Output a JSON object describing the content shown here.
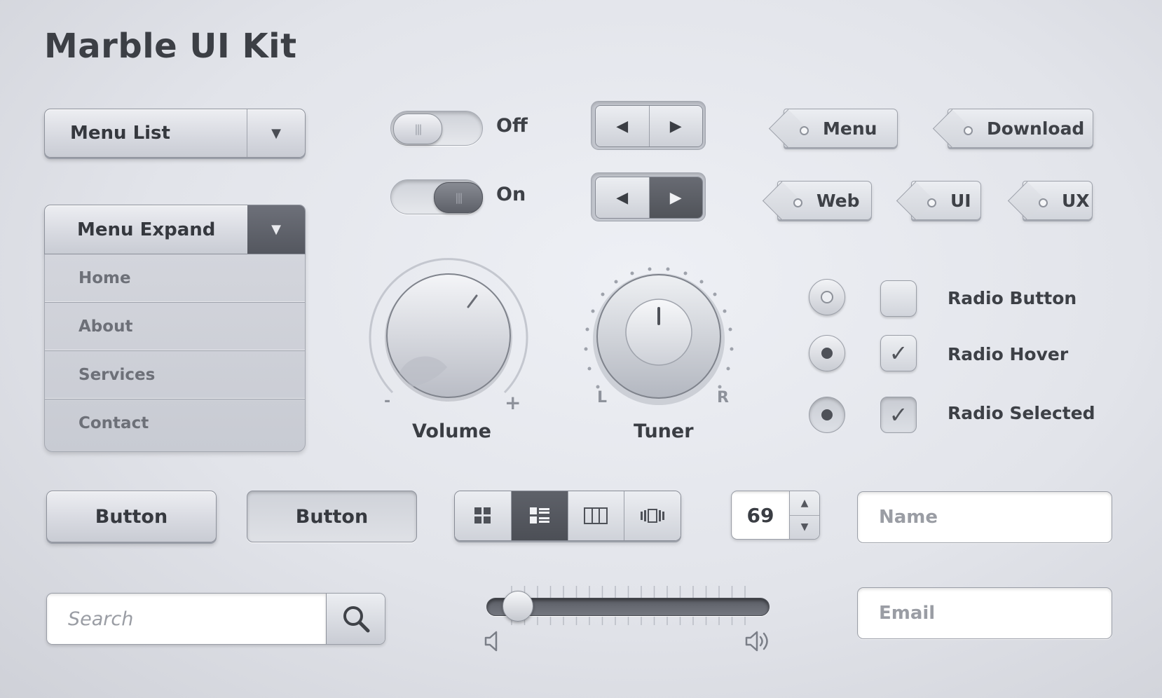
{
  "title": "Marble UI Kit",
  "menu_list": {
    "label": "Menu List",
    "arrow": "▼"
  },
  "menu_expand": {
    "label": "Menu Expand",
    "arrow": "▼",
    "items": [
      "Home",
      "About",
      "Services",
      "Contact"
    ]
  },
  "toggles": [
    {
      "label": "Off",
      "state": "off"
    },
    {
      "label": "On",
      "state": "on"
    }
  ],
  "arrow_buttons": {
    "left": "◀",
    "right": "▶"
  },
  "tags": [
    "Menu",
    "Download",
    "Web",
    "UI",
    "UX"
  ],
  "knobs": {
    "volume": {
      "label": "Volume",
      "min": "-",
      "max": "+"
    },
    "tuner": {
      "label": "Tuner",
      "left": "L",
      "right": "R"
    }
  },
  "radios": [
    {
      "label": "Radio Button",
      "checked": false
    },
    {
      "label": "Radio Hover",
      "checked": true
    },
    {
      "label": "Radio Selected",
      "checked": true
    }
  ],
  "check_mark": "✓",
  "buttons": [
    "Button",
    "Button"
  ],
  "stepper": {
    "value": "69",
    "up": "▲",
    "down": "▼"
  },
  "fields": {
    "name_placeholder": "Name",
    "email_placeholder": "Email"
  },
  "search": {
    "placeholder": "Search"
  },
  "slider": {
    "value": 0.05
  },
  "icons": {
    "search": "magnifier-icon",
    "volume_low": "speaker-low-icon",
    "volume_high": "speaker-high-icon",
    "views": [
      "grid-view-icon",
      "list-view-icon",
      "column-view-icon",
      "cover-flow-icon"
    ]
  },
  "colors": {
    "accent_dark": "#54575f",
    "metal_light": "#edeef2",
    "text": "#3d4046"
  }
}
